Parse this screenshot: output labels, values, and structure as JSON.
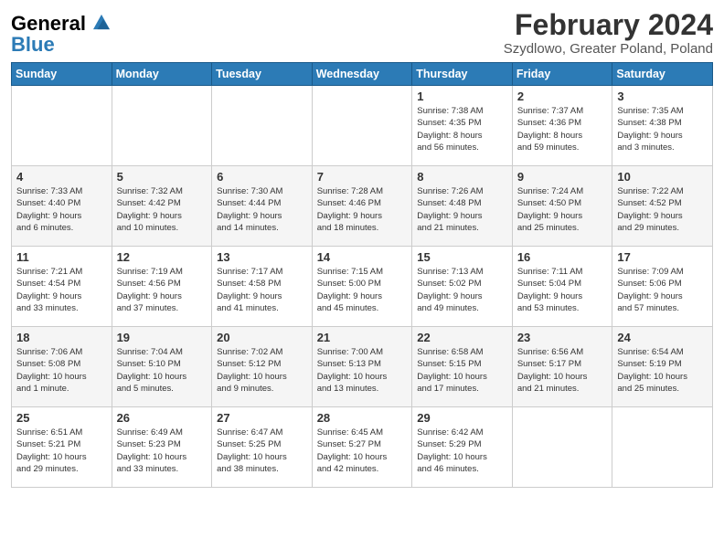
{
  "header": {
    "logo_line1": "General",
    "logo_line2": "Blue",
    "month": "February 2024",
    "location": "Szydlowo, Greater Poland, Poland"
  },
  "weekdays": [
    "Sunday",
    "Monday",
    "Tuesday",
    "Wednesday",
    "Thursday",
    "Friday",
    "Saturday"
  ],
  "weeks": [
    [
      {
        "day": "",
        "info": ""
      },
      {
        "day": "",
        "info": ""
      },
      {
        "day": "",
        "info": ""
      },
      {
        "day": "",
        "info": ""
      },
      {
        "day": "1",
        "info": "Sunrise: 7:38 AM\nSunset: 4:35 PM\nDaylight: 8 hours\nand 56 minutes."
      },
      {
        "day": "2",
        "info": "Sunrise: 7:37 AM\nSunset: 4:36 PM\nDaylight: 8 hours\nand 59 minutes."
      },
      {
        "day": "3",
        "info": "Sunrise: 7:35 AM\nSunset: 4:38 PM\nDaylight: 9 hours\nand 3 minutes."
      }
    ],
    [
      {
        "day": "4",
        "info": "Sunrise: 7:33 AM\nSunset: 4:40 PM\nDaylight: 9 hours\nand 6 minutes."
      },
      {
        "day": "5",
        "info": "Sunrise: 7:32 AM\nSunset: 4:42 PM\nDaylight: 9 hours\nand 10 minutes."
      },
      {
        "day": "6",
        "info": "Sunrise: 7:30 AM\nSunset: 4:44 PM\nDaylight: 9 hours\nand 14 minutes."
      },
      {
        "day": "7",
        "info": "Sunrise: 7:28 AM\nSunset: 4:46 PM\nDaylight: 9 hours\nand 18 minutes."
      },
      {
        "day": "8",
        "info": "Sunrise: 7:26 AM\nSunset: 4:48 PM\nDaylight: 9 hours\nand 21 minutes."
      },
      {
        "day": "9",
        "info": "Sunrise: 7:24 AM\nSunset: 4:50 PM\nDaylight: 9 hours\nand 25 minutes."
      },
      {
        "day": "10",
        "info": "Sunrise: 7:22 AM\nSunset: 4:52 PM\nDaylight: 9 hours\nand 29 minutes."
      }
    ],
    [
      {
        "day": "11",
        "info": "Sunrise: 7:21 AM\nSunset: 4:54 PM\nDaylight: 9 hours\nand 33 minutes."
      },
      {
        "day": "12",
        "info": "Sunrise: 7:19 AM\nSunset: 4:56 PM\nDaylight: 9 hours\nand 37 minutes."
      },
      {
        "day": "13",
        "info": "Sunrise: 7:17 AM\nSunset: 4:58 PM\nDaylight: 9 hours\nand 41 minutes."
      },
      {
        "day": "14",
        "info": "Sunrise: 7:15 AM\nSunset: 5:00 PM\nDaylight: 9 hours\nand 45 minutes."
      },
      {
        "day": "15",
        "info": "Sunrise: 7:13 AM\nSunset: 5:02 PM\nDaylight: 9 hours\nand 49 minutes."
      },
      {
        "day": "16",
        "info": "Sunrise: 7:11 AM\nSunset: 5:04 PM\nDaylight: 9 hours\nand 53 minutes."
      },
      {
        "day": "17",
        "info": "Sunrise: 7:09 AM\nSunset: 5:06 PM\nDaylight: 9 hours\nand 57 minutes."
      }
    ],
    [
      {
        "day": "18",
        "info": "Sunrise: 7:06 AM\nSunset: 5:08 PM\nDaylight: 10 hours\nand 1 minute."
      },
      {
        "day": "19",
        "info": "Sunrise: 7:04 AM\nSunset: 5:10 PM\nDaylight: 10 hours\nand 5 minutes."
      },
      {
        "day": "20",
        "info": "Sunrise: 7:02 AM\nSunset: 5:12 PM\nDaylight: 10 hours\nand 9 minutes."
      },
      {
        "day": "21",
        "info": "Sunrise: 7:00 AM\nSunset: 5:13 PM\nDaylight: 10 hours\nand 13 minutes."
      },
      {
        "day": "22",
        "info": "Sunrise: 6:58 AM\nSunset: 5:15 PM\nDaylight: 10 hours\nand 17 minutes."
      },
      {
        "day": "23",
        "info": "Sunrise: 6:56 AM\nSunset: 5:17 PM\nDaylight: 10 hours\nand 21 minutes."
      },
      {
        "day": "24",
        "info": "Sunrise: 6:54 AM\nSunset: 5:19 PM\nDaylight: 10 hours\nand 25 minutes."
      }
    ],
    [
      {
        "day": "25",
        "info": "Sunrise: 6:51 AM\nSunset: 5:21 PM\nDaylight: 10 hours\nand 29 minutes."
      },
      {
        "day": "26",
        "info": "Sunrise: 6:49 AM\nSunset: 5:23 PM\nDaylight: 10 hours\nand 33 minutes."
      },
      {
        "day": "27",
        "info": "Sunrise: 6:47 AM\nSunset: 5:25 PM\nDaylight: 10 hours\nand 38 minutes."
      },
      {
        "day": "28",
        "info": "Sunrise: 6:45 AM\nSunset: 5:27 PM\nDaylight: 10 hours\nand 42 minutes."
      },
      {
        "day": "29",
        "info": "Sunrise: 6:42 AM\nSunset: 5:29 PM\nDaylight: 10 hours\nand 46 minutes."
      },
      {
        "day": "",
        "info": ""
      },
      {
        "day": "",
        "info": ""
      }
    ]
  ]
}
